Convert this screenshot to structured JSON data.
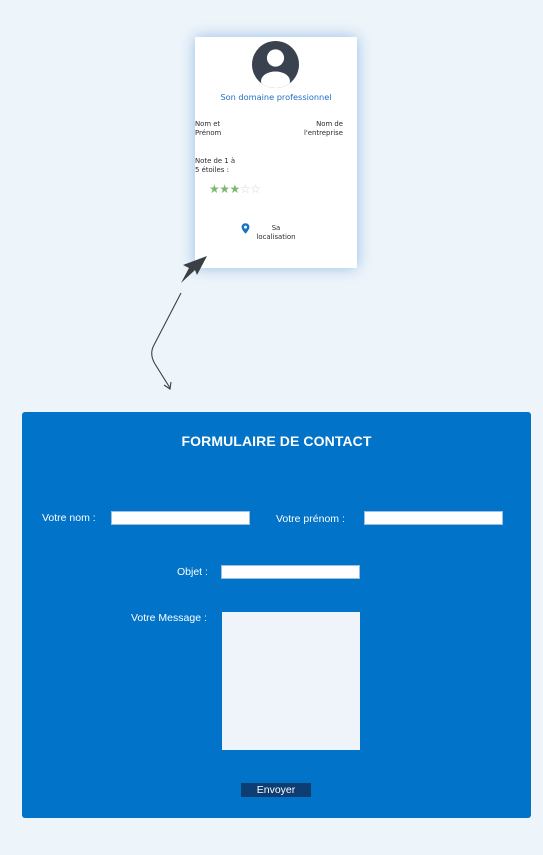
{
  "profile_card": {
    "title": "Son domaine professionnel",
    "name_label_line1": "Nom et",
    "name_label_line2": "Prénom",
    "company_label_line1": "Nom de",
    "company_label_line2": "l'entreprise",
    "rating_label_line1": "Note de 1 à",
    "rating_label_line2": "5 étoiles :",
    "rating": {
      "filled": 3,
      "total": 5
    },
    "star_filled_char": "★",
    "star_empty_char": "☆",
    "location_label_line1": "Sa",
    "location_label_line2": "localisation",
    "avatar_icon": "user-avatar-icon",
    "location_icon": "map-pin-icon"
  },
  "form": {
    "title": "FORMULAIRE DE CONTACT",
    "last_name_label": "Votre nom :",
    "first_name_label": "Votre prénom :",
    "subject_label": "Objet :",
    "message_label": "Votre Message :",
    "submit_label": "Envoyer"
  },
  "colors": {
    "background": "#eef5fa",
    "form_background": "#0173c9",
    "button_background": "#0d3d72",
    "card_title": "#1f6fc4",
    "star_filled": "#7bb86f",
    "avatar": "#3a4250"
  }
}
